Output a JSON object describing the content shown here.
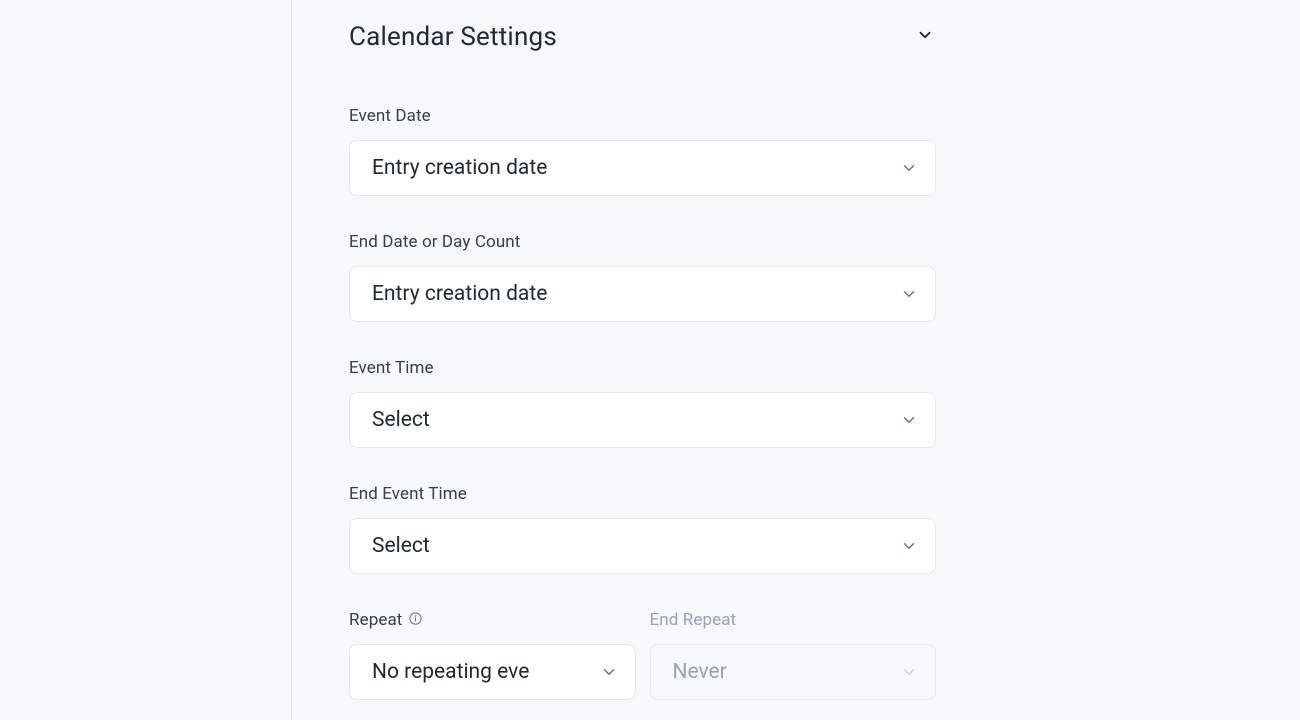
{
  "section": {
    "title": "Calendar Settings"
  },
  "fields": {
    "event_date": {
      "label": "Event Date",
      "value": "Entry creation date"
    },
    "end_date": {
      "label": "End Date or Day Count",
      "value": "Entry creation date"
    },
    "event_time": {
      "label": "Event Time",
      "value": "Select"
    },
    "end_event_time": {
      "label": "End Event Time",
      "value": "Select"
    },
    "repeat": {
      "label": "Repeat",
      "value": "No repeating eve"
    },
    "end_repeat": {
      "label": "End Repeat",
      "value": "Never"
    }
  }
}
